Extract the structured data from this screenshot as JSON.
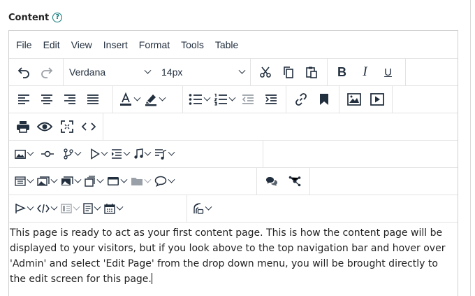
{
  "field": {
    "label": "Content",
    "help_icon": "question-circle-icon",
    "accent": "#0f7a7a"
  },
  "menubar": [
    "File",
    "Edit",
    "View",
    "Insert",
    "Format",
    "Tools",
    "Table"
  ],
  "toolbar": {
    "font_family": "Verdana",
    "font_size": "14px"
  },
  "editor": {
    "content": "This page is ready to act as your first content page. This is how the content page will be displayed to your visitors, but if you look above to the top navigation bar and hover over 'Admin' and select 'Edit Page' from the drop down menu, you will be brought directly to the edit screen for this page."
  },
  "colors": {
    "text": "#222f3e",
    "border": "#cfcfcf",
    "divider": "#e3e3e3"
  }
}
